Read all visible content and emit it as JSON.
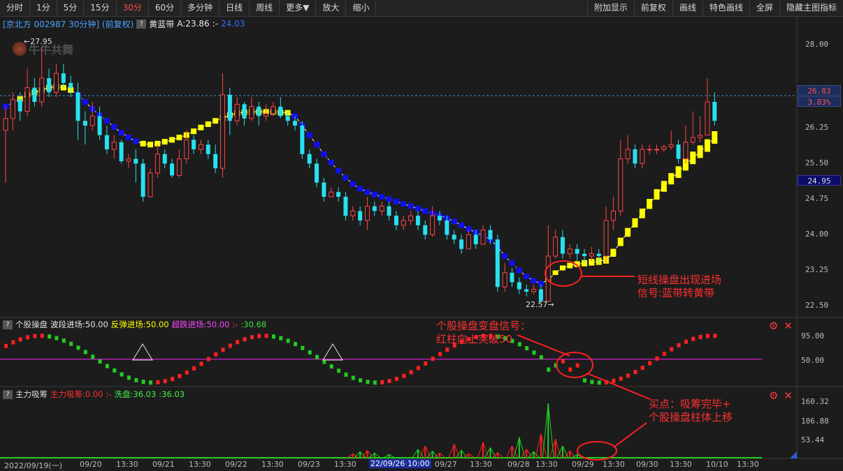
{
  "toolbar": {
    "left": [
      "分时",
      "1分",
      "5分",
      "15分",
      "30分",
      "60分",
      "多分钟",
      "日线",
      "周线",
      "更多▼",
      "放大",
      "缩小"
    ],
    "right": [
      "附加显示",
      "前复权",
      "画线",
      "特色画线",
      "全屏",
      "隐藏主图指标"
    ],
    "active": "30分"
  },
  "header": {
    "stock": "[京北方 002987 30分钟] (前复权)",
    "indicator_name": "黄蓝带",
    "indicator_a": "A:23.86",
    "indicator_sep": ":-",
    "indicator_b": "24.03",
    "help": "?"
  },
  "logo": "牛牛共舞",
  "main_axis": {
    "ticks": [
      "28.00",
      "26.25",
      "25.50",
      "24.75",
      "24.00",
      "23.25",
      "22.50"
    ],
    "current_price": "26.83",
    "current_pct": "3.83%",
    "blue_level": "24.95",
    "high_label": "27.95",
    "low_label": "22.57"
  },
  "sub1": {
    "help": "?",
    "name": "个股操盘",
    "l1": "波段进场:50.00",
    "l2": "反弹进场:50.00",
    "l3": "超跌进场:50.00",
    "sep": ":-",
    "val": ":30.68",
    "ticks": [
      "95.00",
      "50.00"
    ]
  },
  "sub2": {
    "help": "?",
    "name": "主力吸筹",
    "l1": "主力吸筹:0.00",
    "sep": ":-",
    "l2": "洗盘:36.03",
    "val": ":36.03",
    "ticks": [
      "160.32",
      "106.88",
      "53.44"
    ]
  },
  "icons": {
    "settings": "⚙",
    "close": "✕"
  },
  "xaxis": [
    "2022/09/19(一)",
    "09/20",
    "13:30",
    "09/21",
    "13:30",
    "09/22",
    "13:30",
    "09/23",
    "13:30",
    "22/09/26 10:00",
    "09/27",
    "13:30",
    "09/28",
    "13:30",
    "09/29",
    "13:30",
    "09/30",
    "13:30",
    "10/10",
    "13:30"
  ],
  "annotations": {
    "a1": [
      "短线操盘出现进场",
      "信号:蓝带转黄带"
    ],
    "a2": [
      "个股操盘变盘信号：",
      "红柱向上突破50"
    ],
    "a3": [
      "买点：吸筹完毕+",
      "个股操盘柱体上移"
    ]
  },
  "colors": {
    "up": "#ff4444",
    "down": "#28e0f0",
    "yellow": "#ffff00",
    "blue": "#1010ee",
    "magenta": "#cc22cc",
    "green": "#22cc22",
    "red": "#ff2020"
  },
  "chart_data": {
    "type": "candlestick",
    "ylim": [
      22.3,
      28.3
    ],
    "candles": [
      [
        26.2,
        26.45,
        26.7,
        25.1
      ],
      [
        26.45,
        26.85,
        27.0,
        26.2
      ],
      [
        26.85,
        26.6,
        27.0,
        26.4
      ],
      [
        26.6,
        27.1,
        27.5,
        26.5
      ],
      [
        27.1,
        26.8,
        27.3,
        26.7
      ],
      [
        26.8,
        27.3,
        27.95,
        26.7
      ],
      [
        27.3,
        27.0,
        27.5,
        26.9
      ],
      [
        27.0,
        27.4,
        27.6,
        26.9
      ],
      [
        27.4,
        27.2,
        27.6,
        27.1
      ],
      [
        27.2,
        27.1,
        27.35,
        26.9
      ],
      [
        27.0,
        26.4,
        27.2,
        26.0
      ],
      [
        26.4,
        26.3,
        26.6,
        25.9
      ],
      [
        26.3,
        26.5,
        26.8,
        26.2
      ],
      [
        26.5,
        26.1,
        26.7,
        26.0
      ],
      [
        26.1,
        25.8,
        26.3,
        25.7
      ],
      [
        25.8,
        25.95,
        26.1,
        25.6
      ],
      [
        25.95,
        25.55,
        26.0,
        25.5
      ],
      [
        25.55,
        25.6,
        25.7,
        25.4
      ],
      [
        25.6,
        25.5,
        25.8,
        25.1
      ],
      [
        25.5,
        24.8,
        25.6,
        24.7
      ],
      [
        24.8,
        25.3,
        25.4,
        24.9
      ],
      [
        25.3,
        25.7,
        25.9,
        25.2
      ],
      [
        25.7,
        25.5,
        25.8,
        25.4
      ],
      [
        25.5,
        25.25,
        25.6,
        25.2
      ],
      [
        25.25,
        25.6,
        25.8,
        25.2
      ],
      [
        25.6,
        26.0,
        26.2,
        25.5
      ],
      [
        26.0,
        25.8,
        26.1,
        25.7
      ],
      [
        25.8,
        25.9,
        26.0,
        25.7
      ],
      [
        25.9,
        25.7,
        26.0,
        25.6
      ],
      [
        25.7,
        25.4,
        25.9,
        25.3
      ],
      [
        25.4,
        26.95,
        27.4,
        25.2
      ],
      [
        26.95,
        26.4,
        27.1,
        26.1
      ],
      [
        26.4,
        26.75,
        26.9,
        26.3
      ],
      [
        26.75,
        26.45,
        26.8,
        26.3
      ],
      [
        26.45,
        26.7,
        26.9,
        26.4
      ],
      [
        26.7,
        26.5,
        26.8,
        26.3
      ],
      [
        26.5,
        26.55,
        26.75,
        26.4
      ],
      [
        26.55,
        26.7,
        26.8,
        26.5
      ],
      [
        26.7,
        26.5,
        26.9,
        26.45
      ],
      [
        26.5,
        26.4,
        26.6,
        26.3
      ],
      [
        26.4,
        26.3,
        26.5,
        26.2
      ],
      [
        26.3,
        25.7,
        26.4,
        25.6
      ],
      [
        25.7,
        25.5,
        25.8,
        25.4
      ],
      [
        25.5,
        25.1,
        25.6,
        25.0
      ],
      [
        25.1,
        24.8,
        25.2,
        24.7
      ],
      [
        24.8,
        24.9,
        25.0,
        24.8
      ],
      [
        24.9,
        24.8,
        25.0,
        24.7
      ],
      [
        24.8,
        24.4,
        24.9,
        24.3
      ],
      [
        24.4,
        24.5,
        24.6,
        24.3
      ],
      [
        24.5,
        24.3,
        24.6,
        24.2
      ],
      [
        24.3,
        24.6,
        24.8,
        24.1
      ],
      [
        24.6,
        24.5,
        24.7,
        24.4
      ],
      [
        24.5,
        24.6,
        24.7,
        24.4
      ],
      [
        24.6,
        24.4,
        24.7,
        24.3
      ],
      [
        24.4,
        24.2,
        24.5,
        24.1
      ],
      [
        24.2,
        24.3,
        24.4,
        24.1
      ],
      [
        24.3,
        24.4,
        24.5,
        24.2
      ],
      [
        24.4,
        24.2,
        24.5,
        24.1
      ],
      [
        24.2,
        24.0,
        24.3,
        23.9
      ],
      [
        24.0,
        24.4,
        24.6,
        23.95
      ],
      [
        24.4,
        24.3,
        24.5,
        24.2
      ],
      [
        24.3,
        24.0,
        24.4,
        23.9
      ],
      [
        24.0,
        23.9,
        24.1,
        23.8
      ],
      [
        23.9,
        23.7,
        24.0,
        23.6
      ],
      [
        23.7,
        24.0,
        24.1,
        23.7
      ],
      [
        24.0,
        23.8,
        24.1,
        23.7
      ],
      [
        23.8,
        24.1,
        24.2,
        23.8
      ],
      [
        24.1,
        23.9,
        24.2,
        23.8
      ],
      [
        23.9,
        22.9,
        24.0,
        22.8
      ],
      [
        22.9,
        23.2,
        23.4,
        22.8
      ],
      [
        23.2,
        23.0,
        23.3,
        22.9
      ],
      [
        23.0,
        22.85,
        23.1,
        22.75
      ],
      [
        22.85,
        22.8,
        22.95,
        22.7
      ],
      [
        22.8,
        22.85,
        22.95,
        22.75
      ],
      [
        22.85,
        22.6,
        22.95,
        22.57
      ],
      [
        22.6,
        23.55,
        24.2,
        22.8
      ],
      [
        23.55,
        23.95,
        24.1,
        23.5
      ],
      [
        23.95,
        23.6,
        24.1,
        23.5
      ],
      [
        23.6,
        23.7,
        23.8,
        23.5
      ],
      [
        23.7,
        23.6,
        23.8,
        23.45
      ],
      [
        23.6,
        23.55,
        23.7,
        23.4
      ],
      [
        23.55,
        23.6,
        23.75,
        23.45
      ],
      [
        23.6,
        23.55,
        23.7,
        23.4
      ],
      [
        23.55,
        24.3,
        24.6,
        23.4
      ],
      [
        24.3,
        24.5,
        24.8,
        24.1
      ],
      [
        24.5,
        25.6,
        26.0,
        24.4
      ],
      [
        25.6,
        25.8,
        26.1,
        25.5
      ],
      [
        25.8,
        25.5,
        25.9,
        25.4
      ],
      [
        25.5,
        25.8,
        25.9,
        25.4
      ],
      [
        25.8,
        25.8,
        25.9,
        25.7
      ],
      [
        25.8,
        25.8,
        25.9,
        25.7
      ],
      [
        25.8,
        25.85,
        25.9,
        25.75
      ],
      [
        25.85,
        25.9,
        26.2,
        25.8
      ],
      [
        25.9,
        25.6,
        26.0,
        25.5
      ],
      [
        25.6,
        25.95,
        26.3,
        25.5
      ],
      [
        25.95,
        26.05,
        26.6,
        25.9
      ],
      [
        26.05,
        26.1,
        26.5,
        25.95
      ],
      [
        26.1,
        26.8,
        27.3,
        26.1
      ],
      [
        26.8,
        26.4,
        27.0,
        26.3
      ]
    ],
    "band": [
      26.7,
      26.78,
      26.86,
      26.95,
      27.0,
      27.05,
      27.1,
      27.12,
      27.1,
      27.05,
      26.95,
      26.8,
      26.65,
      26.52,
      26.4,
      26.27,
      26.15,
      26.05,
      25.97,
      25.92,
      25.9,
      25.92,
      25.96,
      26.0,
      26.05,
      26.1,
      26.18,
      26.26,
      26.33,
      26.4,
      26.46,
      26.52,
      26.56,
      26.58,
      26.59,
      26.59,
      26.59,
      26.59,
      26.58,
      26.57,
      26.5,
      26.3,
      26.1,
      25.9,
      25.7,
      25.52,
      25.35,
      25.2,
      25.07,
      24.97,
      24.9,
      24.85,
      24.8,
      24.75,
      24.7,
      24.65,
      24.6,
      24.55,
      24.5,
      24.45,
      24.4,
      24.35,
      24.28,
      24.2,
      24.12,
      24.05,
      23.98,
      23.9,
      23.75,
      23.55,
      23.4,
      23.25,
      23.12,
      23.03,
      22.97,
      23.05,
      23.2,
      23.3,
      23.35,
      23.38,
      23.4,
      23.42,
      23.44,
      23.47,
      23.62,
      23.85,
      24.05,
      24.25,
      24.45,
      24.65,
      24.85,
      25.02,
      25.18,
      25.32,
      25.48,
      25.62,
      25.75,
      25.88,
      26.05
    ],
    "band_yellow_ranges": [
      [
        2,
        9
      ],
      [
        19,
        39
      ],
      [
        75,
        99
      ]
    ]
  }
}
